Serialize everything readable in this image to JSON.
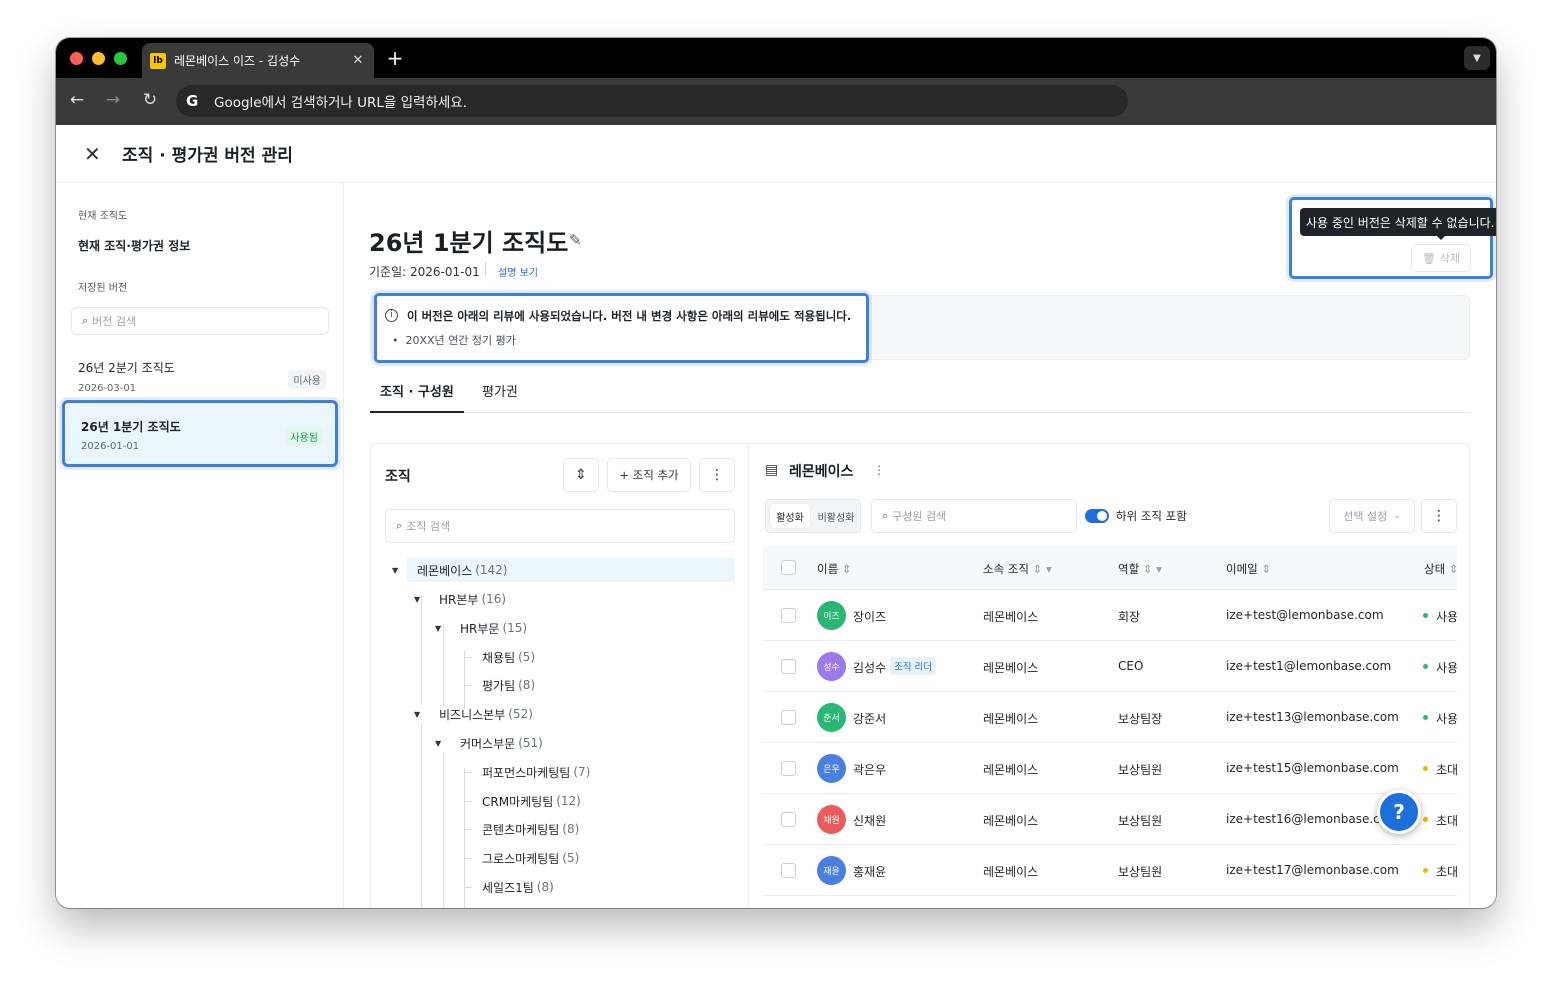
{
  "browser": {
    "tab_title": "레몬베이스 이즈 - 김성수",
    "favicon_text": "lb",
    "tab_close": "✕",
    "new_tab": "+",
    "omnibox_icon": "G",
    "omnibox_placeholder": "Google에서 검색하거나 URL을 입력하세요.",
    "traffic_lights": [
      "#ff5f57",
      "#febc2e",
      "#28c840"
    ]
  },
  "header": {
    "close_icon": "✕",
    "title": "조직 · 평가권 버전 관리"
  },
  "sidebar": {
    "current_caption": "현재 조직도",
    "current_item": "현재 조직·평가권 정보",
    "saved_caption": "저장된 버전",
    "search_placeholder": "버전 검색",
    "versions": [
      {
        "name": "26년 2분기 조직도",
        "date": "2026-03-01",
        "badge": "미사용"
      },
      {
        "name": "26년 1분기 조직도",
        "date": "2026-01-01",
        "badge": "사용됨"
      }
    ]
  },
  "main": {
    "title": "26년 1분기 조직도",
    "base_date": "기준일: 2026-01-01",
    "help_link": "설명 보기",
    "tooltip": "사용 중인 버전은 삭제할 수 없습니다.",
    "delete_label": "삭제",
    "notice": {
      "message": "이 버전은 아래의 리뷰에 사용되었습니다. 버전 내 변경 사항은 아래의 리뷰에도 적용됩니다.",
      "item": "20XX년 연간 정기 평가"
    },
    "tabs": [
      "조직 · 구성원",
      "평가권"
    ]
  },
  "org": {
    "title": "조직",
    "add_label": "+ 조직 추가",
    "search_placeholder": "조직 검색",
    "tree": [
      {
        "name": "레몬베이스",
        "count": "(142)"
      },
      {
        "name": "HR본부",
        "count": "(16)"
      },
      {
        "name": "HR부문",
        "count": "(15)"
      },
      {
        "name": "채용팀",
        "count": "(5)"
      },
      {
        "name": "평가팀",
        "count": "(8)"
      },
      {
        "name": "비즈니스본부",
        "count": "(52)"
      },
      {
        "name": "커머스부문",
        "count": "(51)"
      },
      {
        "name": "퍼포먼스마케팅팀",
        "count": "(7)"
      },
      {
        "name": "CRM마케팅팀",
        "count": "(12)"
      },
      {
        "name": "콘텐츠마케팅팀",
        "count": "(8)"
      },
      {
        "name": "그로스마케팅팀",
        "count": "(5)"
      },
      {
        "name": "세일즈1팀",
        "count": "(8)"
      }
    ]
  },
  "members": {
    "org_name": "레몬베이스",
    "seg_active": "활성화",
    "seg_inactive": "비활성화",
    "search_placeholder": "구성원 검색",
    "toggle_label": "하위 조직 포함",
    "select_label": "선택 설정",
    "columns": [
      "이름",
      "소속 조직",
      "역할",
      "이메일",
      "상태"
    ],
    "rows": [
      {
        "avatar": "이즈",
        "color": "#2bb673",
        "name": "장이즈",
        "leader": "",
        "org": "레몬베이스",
        "role": "회장",
        "email": "ize+test@lemonbase.com",
        "status": "사용",
        "status_color": "#2bb673"
      },
      {
        "avatar": "성수",
        "color": "#9b7bea",
        "name": "김성수",
        "leader": "조직 리더",
        "org": "레몬베이스",
        "role": "CEO",
        "email": "ize+test1@lemonbase.com",
        "status": "사용",
        "status_color": "#2bb673"
      },
      {
        "avatar": "준서",
        "color": "#2bb673",
        "name": "강준서",
        "leader": "",
        "org": "레몬베이스",
        "role": "보상팀장",
        "email": "ize+test13@lemonbase.com",
        "status": "사용",
        "status_color": "#2bb673"
      },
      {
        "avatar": "은우",
        "color": "#4a7fe0",
        "name": "곽은우",
        "leader": "",
        "org": "레몬베이스",
        "role": "보상팀원",
        "email": "ize+test15@lemonbase.com",
        "status": "초대",
        "status_color": "#f5b400"
      },
      {
        "avatar": "채원",
        "color": "#ec5b5b",
        "name": "신채원",
        "leader": "",
        "org": "레몬베이스",
        "role": "보상팀원",
        "email": "ize+test16@lemonbase.com",
        "status": "초대",
        "status_color": "#f5b400"
      },
      {
        "avatar": "재윤",
        "color": "#4a7fe0",
        "name": "홍재윤",
        "leader": "",
        "org": "레몬베이스",
        "role": "보상팀원",
        "email": "ize+test17@lemonbase.com",
        "status": "초대",
        "status_color": "#f5b400"
      }
    ]
  },
  "help_fab": "?",
  "colors": {
    "accent": "#1e6fd9",
    "highlight": "#3f7fd8",
    "used_badge": "#1f9d57",
    "used_badge_bg": "#e3f6ec"
  }
}
